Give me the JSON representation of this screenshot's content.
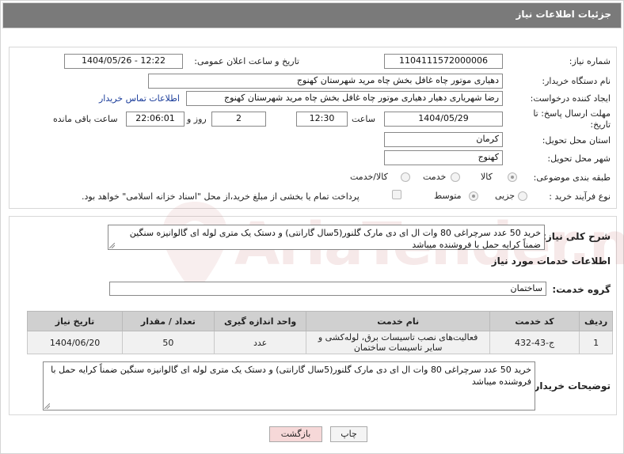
{
  "header": {
    "title": "جزئیات اطلاعات نیاز"
  },
  "fields": {
    "need_number_label": "شماره نیاز:",
    "need_number": "1104111572000006",
    "announce_label": "تاریخ و ساعت اعلان عمومی:",
    "announce_value": "1404/05/26 - 12:22",
    "buyer_org_label": "نام دستگاه خریدار:",
    "buyer_org": "دهیاری موتور چاه غافل بخش چاه مرید شهرستان کهنوج",
    "creator_label": "ایجاد کننده درخواست:",
    "creator": "رضا شهریاری دهیار دهیاری موتور چاه غافل بخش چاه مرید شهرستان کهنوج",
    "contact_link": "اطلاعات تماس خریدار",
    "deadline_label": "مهلت ارسال پاسخ: تا تاریخ:",
    "deadline_date": "1404/05/29",
    "time_label": "ساعت",
    "deadline_time": "12:30",
    "days_value": "2",
    "days_label": "روز و",
    "remaining_time": "22:06:01",
    "remaining_label": "ساعت باقی مانده",
    "province_label": "استان محل تحویل:",
    "province": "کرمان",
    "city_label": "شهر محل تحویل:",
    "city": "کهنوج",
    "category_label": "طبقه بندی موضوعی:",
    "category_options": [
      "کالا",
      "خدمت",
      "کالا/خدمت"
    ],
    "process_label": "نوع فرآیند خرید :",
    "process_options": [
      "جزیی",
      "متوسط"
    ],
    "payment_note": "پرداخت تمام یا بخشی از مبلغ خرید،از محل \"اسناد خزانه اسلامی\" خواهد بود."
  },
  "summary": {
    "label": "شرح کلی نیاز:",
    "text": "خرید 50 عدد سرچراغی 80 وات ال ای دی مارک گلنور(5سال گارانتی) و دستک یک متری لوله ای گالوانیزه سنگین ضمناً  کرایه حمل با فروشنده میباشد"
  },
  "services": {
    "section_title": "اطلاعات خدمات مورد نیاز",
    "group_label": "گروه خدمت:",
    "group_value": "ساختمان",
    "columns": [
      "ردیف",
      "کد خدمت",
      "نام خدمت",
      "واحد اندازه گیری",
      "تعداد / مقدار",
      "تاریخ نیاز"
    ],
    "rows": [
      {
        "idx": "1",
        "code": "ج-43-432",
        "name": "فعالیت‌های نصب تاسیسات برق، لوله‌کشی و سایر تاسیسات ساختمان",
        "unit": "عدد",
        "qty": "50",
        "date": "1404/06/20"
      }
    ]
  },
  "buyer_notes": {
    "label": "توضیحات خریدار:",
    "text": "خرید 50 عدد  سرچراغی 80 وات ال ای دی مارک گلنور(5سال گارانتی) و دستک یک متری لوله ای گالوانیزه سنگین  ضمناً  کرایه حمل با فروشنده میباشد"
  },
  "buttons": {
    "print": "چاپ",
    "back": "بازگشت"
  },
  "watermark": "AriaTender.neT",
  "colors": {
    "header_bg": "#7a7a7a",
    "link": "#1a3c9a",
    "back_btn_bg": "#f6d8d8"
  }
}
